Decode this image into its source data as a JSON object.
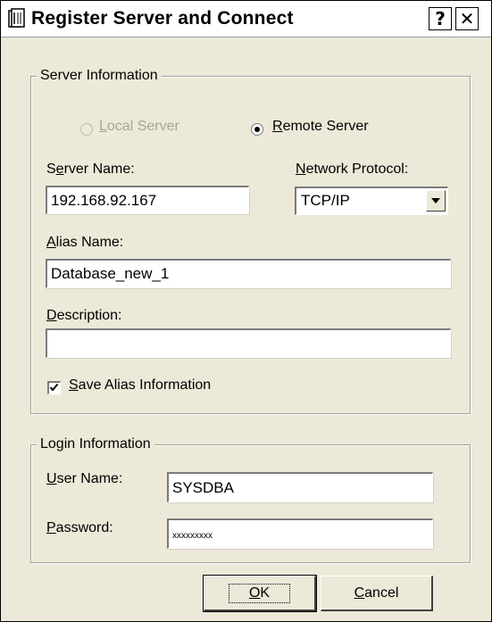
{
  "window": {
    "title": "Register Server and Connect",
    "help_label": "?",
    "close_label": "✕"
  },
  "server_info": {
    "legend": "Server Information",
    "local_server": {
      "pre": "",
      "key": "L",
      "post": "ocal Server",
      "selected": false,
      "enabled": false
    },
    "remote_server": {
      "pre": "",
      "key": "R",
      "post": "emote Server",
      "selected": true,
      "enabled": true
    },
    "server_name": {
      "pre": "S",
      "key": "e",
      "post": "rver Name:",
      "value": "192.168.92.167"
    },
    "network_protocol": {
      "pre": "",
      "key": "N",
      "post": "etwork Protocol:",
      "selected": "TCP/IP"
    },
    "alias_name": {
      "pre": "",
      "key": "A",
      "post": "lias Name:",
      "value": "Database_new_1"
    },
    "description": {
      "pre": "",
      "key": "D",
      "post": "escription:",
      "value": ""
    },
    "save_alias": {
      "pre": "",
      "key": "S",
      "post": "ave Alias Information",
      "checked": true
    }
  },
  "login_info": {
    "legend": "Login Information",
    "user_name": {
      "pre": "",
      "key": "U",
      "post": "ser Name:",
      "value": "SYSDBA"
    },
    "password": {
      "pre": "",
      "key": "P",
      "post": "assword:",
      "value": "xxxxxxxxx"
    }
  },
  "buttons": {
    "ok": {
      "pre": "",
      "key": "O",
      "post": "K"
    },
    "cancel": {
      "pre": "",
      "key": "C",
      "post": "ancel"
    }
  },
  "colors": {
    "dialog_bg": "#ece9d8",
    "disabled_text": "#a7a596"
  }
}
